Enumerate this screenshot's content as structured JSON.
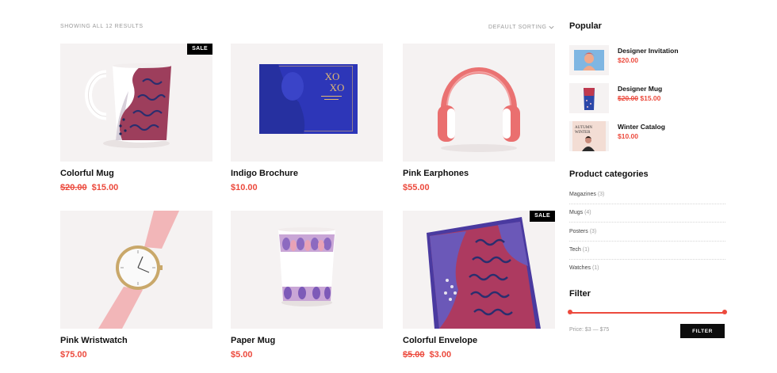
{
  "toolbar": {
    "result_count": "SHOWING ALL 12 RESULTS",
    "sort_label": "DEFAULT SORTING",
    "sort_icon": "chevron-down-icon"
  },
  "products": [
    {
      "name": "Colorful Mug",
      "old_price": "$20.00",
      "price": "$15.00",
      "badge": "SALE"
    },
    {
      "name": "Indigo Brochure",
      "price": "$10.00",
      "image_text": "XO XO"
    },
    {
      "name": "Pink Earphones",
      "price": "$55.00"
    },
    {
      "name": "Pink Wristwatch",
      "price": "$75.00"
    },
    {
      "name": "Paper Mug",
      "price": "$5.00"
    },
    {
      "name": "Colorful Envelope",
      "old_price": "$5.00",
      "price": "$3.00",
      "badge": "SALE"
    }
  ],
  "sidebar": {
    "popular_title": "Popular",
    "popular": [
      {
        "name": "Designer Invitation",
        "price": "$20.00"
      },
      {
        "name": "Designer Mug",
        "old_price": "$20.00",
        "price": "$15.00"
      },
      {
        "name": "Winter Catalog",
        "price": "$10.00",
        "image_text": "AUTUMN WINTER"
      }
    ],
    "categories_title": "Product categories",
    "categories": [
      {
        "name": "Magazines",
        "count": "(3)"
      },
      {
        "name": "Mugs",
        "count": "(4)"
      },
      {
        "name": "Posters",
        "count": "(3)"
      },
      {
        "name": "Tech",
        "count": "(1)"
      },
      {
        "name": "Watches",
        "count": "(1)"
      }
    ],
    "filter_title": "Filter",
    "price_range": {
      "label": "Price:",
      "min": "$3",
      "separator": "—",
      "max": "$75"
    },
    "filter_button": "FILTER"
  },
  "colors": {
    "accent": "#ec4a3d",
    "badge_bg": "#000000",
    "thumb_bg": "#f5f2f2",
    "button_bg": "#0d0d0d"
  }
}
